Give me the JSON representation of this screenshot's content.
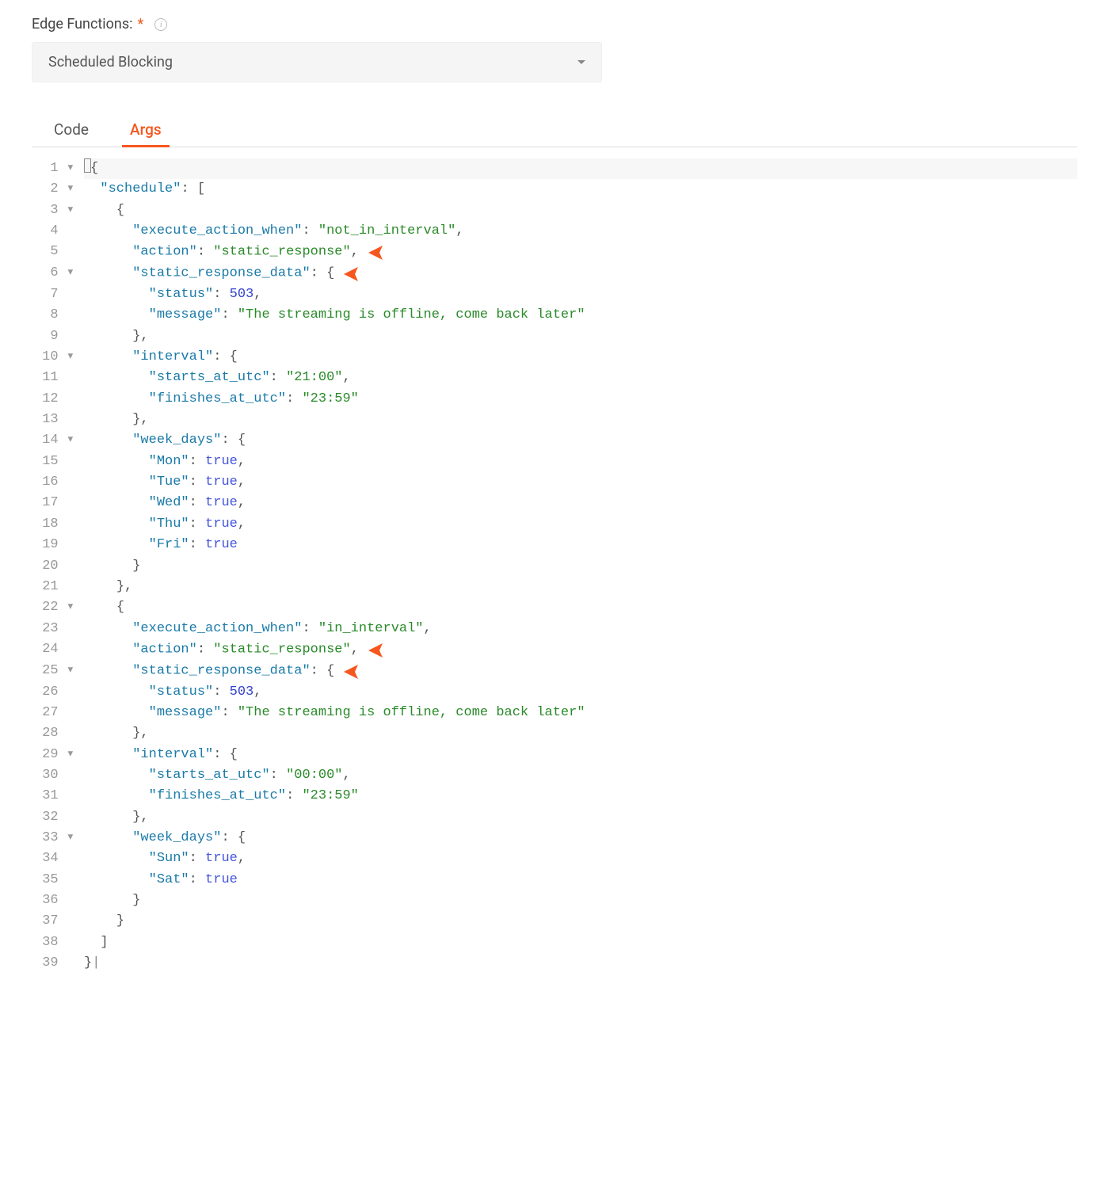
{
  "field": {
    "label": "Edge Functions:",
    "required_marker": "*",
    "select_value": "Scheduled Blocking"
  },
  "tabs": [
    {
      "id": "code",
      "label": "Code",
      "active": false
    },
    {
      "id": "args",
      "label": "Args",
      "active": true
    }
  ],
  "editor_lines": [
    {
      "n": 1,
      "fold": true,
      "hl": true,
      "tokens": [
        {
          "t": "cursor"
        },
        {
          "t": "brace",
          "v": "{"
        }
      ]
    },
    {
      "n": 2,
      "fold": true,
      "hl": false,
      "tokens": [
        {
          "t": "indent",
          "v": "  "
        },
        {
          "t": "key",
          "v": "\"schedule\""
        },
        {
          "t": "punc",
          "v": ": ["
        }
      ]
    },
    {
      "n": 3,
      "fold": true,
      "hl": false,
      "tokens": [
        {
          "t": "indent",
          "v": "    "
        },
        {
          "t": "brace",
          "v": "{"
        }
      ]
    },
    {
      "n": 4,
      "fold": false,
      "hl": false,
      "tokens": [
        {
          "t": "indent",
          "v": "      "
        },
        {
          "t": "key",
          "v": "\"execute_action_when\""
        },
        {
          "t": "punc",
          "v": ": "
        },
        {
          "t": "str",
          "v": "\"not_in_interval\""
        },
        {
          "t": "punc",
          "v": ","
        }
      ]
    },
    {
      "n": 5,
      "fold": false,
      "hl": false,
      "arrow": true,
      "tokens": [
        {
          "t": "indent",
          "v": "      "
        },
        {
          "t": "key",
          "v": "\"action\""
        },
        {
          "t": "punc",
          "v": ": "
        },
        {
          "t": "str",
          "v": "\"static_response\""
        },
        {
          "t": "punc",
          "v": ","
        }
      ]
    },
    {
      "n": 6,
      "fold": true,
      "hl": false,
      "arrow": true,
      "tokens": [
        {
          "t": "indent",
          "v": "      "
        },
        {
          "t": "key",
          "v": "\"static_response_data\""
        },
        {
          "t": "punc",
          "v": ": "
        },
        {
          "t": "brace",
          "v": "{"
        }
      ]
    },
    {
      "n": 7,
      "fold": false,
      "hl": false,
      "tokens": [
        {
          "t": "indent",
          "v": "        "
        },
        {
          "t": "key",
          "v": "\"status\""
        },
        {
          "t": "punc",
          "v": ": "
        },
        {
          "t": "num",
          "v": "503"
        },
        {
          "t": "punc",
          "v": ","
        }
      ]
    },
    {
      "n": 8,
      "fold": false,
      "hl": false,
      "tokens": [
        {
          "t": "indent",
          "v": "        "
        },
        {
          "t": "key",
          "v": "\"message\""
        },
        {
          "t": "punc",
          "v": ": "
        },
        {
          "t": "str",
          "v": "\"The streaming is offline, come back later\""
        }
      ]
    },
    {
      "n": 9,
      "fold": false,
      "hl": false,
      "tokens": [
        {
          "t": "indent",
          "v": "      "
        },
        {
          "t": "brace",
          "v": "}"
        },
        {
          "t": "punc",
          "v": ","
        }
      ]
    },
    {
      "n": 10,
      "fold": true,
      "hl": false,
      "tokens": [
        {
          "t": "indent",
          "v": "      "
        },
        {
          "t": "key",
          "v": "\"interval\""
        },
        {
          "t": "punc",
          "v": ": "
        },
        {
          "t": "brace",
          "v": "{"
        }
      ]
    },
    {
      "n": 11,
      "fold": false,
      "hl": false,
      "tokens": [
        {
          "t": "indent",
          "v": "        "
        },
        {
          "t": "key",
          "v": "\"starts_at_utc\""
        },
        {
          "t": "punc",
          "v": ": "
        },
        {
          "t": "str",
          "v": "\"21:00\""
        },
        {
          "t": "punc",
          "v": ","
        }
      ]
    },
    {
      "n": 12,
      "fold": false,
      "hl": false,
      "tokens": [
        {
          "t": "indent",
          "v": "        "
        },
        {
          "t": "key",
          "v": "\"finishes_at_utc\""
        },
        {
          "t": "punc",
          "v": ": "
        },
        {
          "t": "str",
          "v": "\"23:59\""
        }
      ]
    },
    {
      "n": 13,
      "fold": false,
      "hl": false,
      "tokens": [
        {
          "t": "indent",
          "v": "      "
        },
        {
          "t": "brace",
          "v": "}"
        },
        {
          "t": "punc",
          "v": ","
        }
      ]
    },
    {
      "n": 14,
      "fold": true,
      "hl": false,
      "tokens": [
        {
          "t": "indent",
          "v": "      "
        },
        {
          "t": "key",
          "v": "\"week_days\""
        },
        {
          "t": "punc",
          "v": ": "
        },
        {
          "t": "brace",
          "v": "{"
        }
      ]
    },
    {
      "n": 15,
      "fold": false,
      "hl": false,
      "tokens": [
        {
          "t": "indent",
          "v": "        "
        },
        {
          "t": "key",
          "v": "\"Mon\""
        },
        {
          "t": "punc",
          "v": ": "
        },
        {
          "t": "bool",
          "v": "true"
        },
        {
          "t": "punc",
          "v": ","
        }
      ]
    },
    {
      "n": 16,
      "fold": false,
      "hl": false,
      "tokens": [
        {
          "t": "indent",
          "v": "        "
        },
        {
          "t": "key",
          "v": "\"Tue\""
        },
        {
          "t": "punc",
          "v": ": "
        },
        {
          "t": "bool",
          "v": "true"
        },
        {
          "t": "punc",
          "v": ","
        }
      ]
    },
    {
      "n": 17,
      "fold": false,
      "hl": false,
      "tokens": [
        {
          "t": "indent",
          "v": "        "
        },
        {
          "t": "key",
          "v": "\"Wed\""
        },
        {
          "t": "punc",
          "v": ": "
        },
        {
          "t": "bool",
          "v": "true"
        },
        {
          "t": "punc",
          "v": ","
        }
      ]
    },
    {
      "n": 18,
      "fold": false,
      "hl": false,
      "tokens": [
        {
          "t": "indent",
          "v": "        "
        },
        {
          "t": "key",
          "v": "\"Thu\""
        },
        {
          "t": "punc",
          "v": ": "
        },
        {
          "t": "bool",
          "v": "true"
        },
        {
          "t": "punc",
          "v": ","
        }
      ]
    },
    {
      "n": 19,
      "fold": false,
      "hl": false,
      "tokens": [
        {
          "t": "indent",
          "v": "        "
        },
        {
          "t": "key",
          "v": "\"Fri\""
        },
        {
          "t": "punc",
          "v": ": "
        },
        {
          "t": "bool",
          "v": "true"
        }
      ]
    },
    {
      "n": 20,
      "fold": false,
      "hl": false,
      "tokens": [
        {
          "t": "indent",
          "v": "      "
        },
        {
          "t": "brace",
          "v": "}"
        }
      ]
    },
    {
      "n": 21,
      "fold": false,
      "hl": false,
      "tokens": [
        {
          "t": "indent",
          "v": "    "
        },
        {
          "t": "brace",
          "v": "}"
        },
        {
          "t": "punc",
          "v": ","
        }
      ]
    },
    {
      "n": 22,
      "fold": true,
      "hl": false,
      "tokens": [
        {
          "t": "indent",
          "v": "    "
        },
        {
          "t": "brace",
          "v": "{"
        }
      ]
    },
    {
      "n": 23,
      "fold": false,
      "hl": false,
      "tokens": [
        {
          "t": "indent",
          "v": "      "
        },
        {
          "t": "key",
          "v": "\"execute_action_when\""
        },
        {
          "t": "punc",
          "v": ": "
        },
        {
          "t": "str",
          "v": "\"in_interval\""
        },
        {
          "t": "punc",
          "v": ","
        }
      ]
    },
    {
      "n": 24,
      "fold": false,
      "hl": false,
      "arrow": true,
      "tokens": [
        {
          "t": "indent",
          "v": "      "
        },
        {
          "t": "key",
          "v": "\"action\""
        },
        {
          "t": "punc",
          "v": ": "
        },
        {
          "t": "str",
          "v": "\"static_response\""
        },
        {
          "t": "punc",
          "v": ","
        }
      ]
    },
    {
      "n": 25,
      "fold": true,
      "hl": false,
      "arrow": true,
      "tokens": [
        {
          "t": "indent",
          "v": "      "
        },
        {
          "t": "key",
          "v": "\"static_response_data\""
        },
        {
          "t": "punc",
          "v": ": "
        },
        {
          "t": "brace",
          "v": "{"
        }
      ]
    },
    {
      "n": 26,
      "fold": false,
      "hl": false,
      "tokens": [
        {
          "t": "indent",
          "v": "        "
        },
        {
          "t": "key",
          "v": "\"status\""
        },
        {
          "t": "punc",
          "v": ": "
        },
        {
          "t": "num",
          "v": "503"
        },
        {
          "t": "punc",
          "v": ","
        }
      ]
    },
    {
      "n": 27,
      "fold": false,
      "hl": false,
      "tokens": [
        {
          "t": "indent",
          "v": "        "
        },
        {
          "t": "key",
          "v": "\"message\""
        },
        {
          "t": "punc",
          "v": ": "
        },
        {
          "t": "str",
          "v": "\"The streaming is offline, come back later\""
        }
      ]
    },
    {
      "n": 28,
      "fold": false,
      "hl": false,
      "tokens": [
        {
          "t": "indent",
          "v": "      "
        },
        {
          "t": "brace",
          "v": "}"
        },
        {
          "t": "punc",
          "v": ","
        }
      ]
    },
    {
      "n": 29,
      "fold": true,
      "hl": false,
      "tokens": [
        {
          "t": "indent",
          "v": "      "
        },
        {
          "t": "key",
          "v": "\"interval\""
        },
        {
          "t": "punc",
          "v": ": "
        },
        {
          "t": "brace",
          "v": "{"
        }
      ]
    },
    {
      "n": 30,
      "fold": false,
      "hl": false,
      "tokens": [
        {
          "t": "indent",
          "v": "        "
        },
        {
          "t": "key",
          "v": "\"starts_at_utc\""
        },
        {
          "t": "punc",
          "v": ": "
        },
        {
          "t": "str",
          "v": "\"00:00\""
        },
        {
          "t": "punc",
          "v": ","
        }
      ]
    },
    {
      "n": 31,
      "fold": false,
      "hl": false,
      "tokens": [
        {
          "t": "indent",
          "v": "        "
        },
        {
          "t": "key",
          "v": "\"finishes_at_utc\""
        },
        {
          "t": "punc",
          "v": ": "
        },
        {
          "t": "str",
          "v": "\"23:59\""
        }
      ]
    },
    {
      "n": 32,
      "fold": false,
      "hl": false,
      "tokens": [
        {
          "t": "indent",
          "v": "      "
        },
        {
          "t": "brace",
          "v": "}"
        },
        {
          "t": "punc",
          "v": ","
        }
      ]
    },
    {
      "n": 33,
      "fold": true,
      "hl": false,
      "tokens": [
        {
          "t": "indent",
          "v": "      "
        },
        {
          "t": "key",
          "v": "\"week_days\""
        },
        {
          "t": "punc",
          "v": ": "
        },
        {
          "t": "brace",
          "v": "{"
        }
      ]
    },
    {
      "n": 34,
      "fold": false,
      "hl": false,
      "tokens": [
        {
          "t": "indent",
          "v": "        "
        },
        {
          "t": "key",
          "v": "\"Sun\""
        },
        {
          "t": "punc",
          "v": ": "
        },
        {
          "t": "bool",
          "v": "true"
        },
        {
          "t": "punc",
          "v": ","
        }
      ]
    },
    {
      "n": 35,
      "fold": false,
      "hl": false,
      "tokens": [
        {
          "t": "indent",
          "v": "        "
        },
        {
          "t": "key",
          "v": "\"Sat\""
        },
        {
          "t": "punc",
          "v": ": "
        },
        {
          "t": "bool",
          "v": "true"
        }
      ]
    },
    {
      "n": 36,
      "fold": false,
      "hl": false,
      "tokens": [
        {
          "t": "indent",
          "v": "      "
        },
        {
          "t": "brace",
          "v": "}"
        }
      ]
    },
    {
      "n": 37,
      "fold": false,
      "hl": false,
      "tokens": [
        {
          "t": "indent",
          "v": "    "
        },
        {
          "t": "brace",
          "v": "}"
        }
      ]
    },
    {
      "n": 38,
      "fold": false,
      "hl": false,
      "tokens": [
        {
          "t": "indent",
          "v": "  "
        },
        {
          "t": "punc",
          "v": "]"
        }
      ]
    },
    {
      "n": 39,
      "fold": false,
      "hl": false,
      "tokens": [
        {
          "t": "brace",
          "v": "}"
        },
        {
          "t": "endcursor"
        }
      ]
    }
  ],
  "colors": {
    "accent": "#f5571e"
  }
}
